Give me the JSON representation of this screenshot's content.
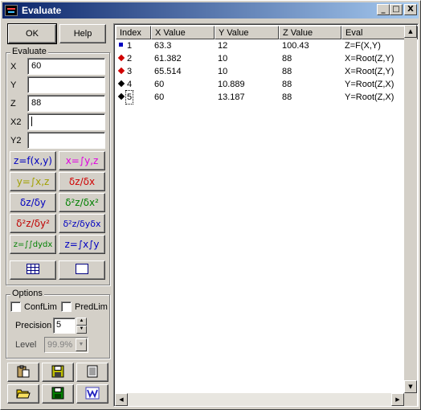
{
  "window": {
    "title": "Evaluate",
    "min_label": "_",
    "max_label": "□",
    "close_label": "X"
  },
  "buttons": {
    "ok": "OK",
    "help": "Help"
  },
  "evaluate": {
    "label": "Evaluate",
    "fields": [
      {
        "label": "X",
        "value": "60"
      },
      {
        "label": "Y",
        "value": ""
      },
      {
        "label": "Z",
        "value": "88"
      },
      {
        "label": "X2",
        "value": ""
      },
      {
        "label": "Y2",
        "value": ""
      }
    ]
  },
  "calc_buttons": [
    {
      "label": "z=f(x,y)",
      "color": "#0000c0"
    },
    {
      "label": "x=∫y,z",
      "color": "#e000e0"
    },
    {
      "label": "y=∫x,z",
      "color": "#a0a000"
    },
    {
      "label": "δz/δx",
      "color": "#d00000"
    },
    {
      "label": "δz/δy",
      "color": "#0000c0"
    },
    {
      "label": "δ²z/δx²",
      "color": "#008000"
    },
    {
      "label": "δ²z/δy²",
      "color": "#c00000"
    },
    {
      "label": "δ²z/δyδx",
      "color": "#0000c0"
    },
    {
      "label": "z=∫∫dydx",
      "color": "#008000"
    },
    {
      "label": "z=∫x∫y",
      "color": "#0000c0"
    }
  ],
  "options": {
    "label": "Options",
    "conflim": "ConfLim",
    "predlim": "PredLim",
    "precision_label": "Precision",
    "precision_value": "5",
    "level_label": "Level",
    "level_value": "99.9%"
  },
  "table": {
    "columns": [
      "Index",
      "X Value",
      "Y Value",
      "Z Value",
      "Eval"
    ],
    "rows": [
      {
        "index": "1",
        "x": "63.3",
        "y": "12",
        "z": "100.43",
        "eval": "Z=F(X,Y)",
        "color": "#0000c0"
      },
      {
        "index": "2",
        "x": "61.382",
        "y": "10",
        "z": "88",
        "eval": "X=Root(Z,Y)",
        "color": "#d00000"
      },
      {
        "index": "3",
        "x": "65.514",
        "y": "10",
        "z": "88",
        "eval": "X=Root(Z,Y)",
        "color": "#d00000"
      },
      {
        "index": "4",
        "x": "60",
        "y": "10.889",
        "z": "88",
        "eval": "Y=Root(Z,X)",
        "color": "#000000"
      },
      {
        "index": "5",
        "x": "60",
        "y": "13.187",
        "z": "88",
        "eval": "Y=Root(Z,X)",
        "color": "#000000"
      }
    ]
  }
}
